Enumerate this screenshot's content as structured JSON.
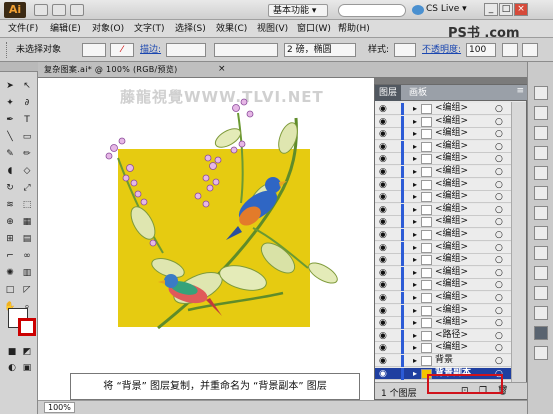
{
  "titlebar": {
    "app_logo": "Ai",
    "workspace": "基本功能 ▾",
    "cslive": "CS Live ▾"
  },
  "menu": [
    "文件(F)",
    "编辑(E)",
    "对象(O)",
    "文字(T)",
    "选择(S)",
    "效果(C)",
    "视图(V)",
    "窗口(W)",
    "帮助(H)"
  ],
  "control": {
    "selection": "未选择对象",
    "stroke_label": "描边:",
    "brush": "2 磅，椭圆",
    "style_label": "样式:",
    "opacity_label": "不透明度:",
    "opacity_value": "100"
  },
  "document": {
    "tab_title": "复杂图案.ai* @ 100% (RGB/预览)",
    "zoom": "100%"
  },
  "watermark": "藤龍視覺WWW.TLVI.NET",
  "site_logo": "PS书 .com",
  "layers_panel": {
    "tabs": [
      "图层",
      "画板"
    ],
    "rows": [
      "<编组>",
      "<编组>",
      "<编组>",
      "<编组>",
      "<编组>",
      "<编组>",
      "<编组>",
      "<编组>",
      "<编组>",
      "<编组>",
      "<编组>",
      "<编组>",
      "<编组>",
      "<编组>",
      "<编组>",
      "<编组>",
      "<编组>",
      "<编组>",
      "<路径>",
      "<编组>",
      "背景",
      "背景副本"
    ],
    "selected_row": "背景副本",
    "footer_label": "1 个图层"
  },
  "caption": "将 “背景” 图层复制，并重命名为 “背景副本” 图层",
  "colors": {
    "artboard": "#e6cb11",
    "selection": "#1f3fa0",
    "highlight": "#d0121b"
  }
}
